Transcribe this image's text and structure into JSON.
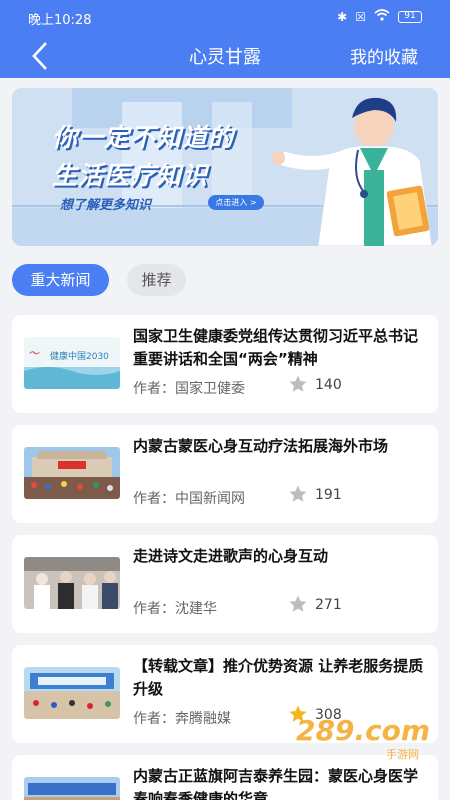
{
  "status_bar": {
    "time": "晚上10:28",
    "battery": "91"
  },
  "nav": {
    "title": "心灵甘露",
    "right_label": "我的收藏"
  },
  "banner": {
    "line1": "你一定不知道的",
    "line2": "生活医疗知识",
    "subtitle": "想了解更多知识",
    "button": "点击进入 >"
  },
  "tabs": [
    {
      "label": "重大新闻"
    },
    {
      "label": "推荐"
    }
  ],
  "author_prefix": "作者：",
  "articles": [
    {
      "title": "国家卫生健康委党组传达贯彻习近平总书记重要讲话和全国“两会”精神",
      "author": "国家卫健委",
      "likes": "140",
      "thumb_text": "健康中国2030"
    },
    {
      "title": "内蒙古蒙医心身互动疗法拓展海外市场",
      "author": "中国新闻网",
      "likes": "191"
    },
    {
      "title": "走进诗文走进歌声的心身互动",
      "author": "沈建华",
      "likes": "271"
    },
    {
      "title": "【转载文章】推介优势资源 让养老服务提质升级",
      "author": "奔腾融媒",
      "likes": "308"
    },
    {
      "title": "内蒙古正蓝旗阿吉泰养生园：蒙医心身医学奏响春季健康的华章"
    }
  ],
  "watermark": {
    "text": "289.com",
    "sub": "手游网"
  },
  "colors": {
    "primary": "#4b7ef3",
    "star_gray": "#bdbdbd",
    "star_gold": "#f3b61f"
  }
}
